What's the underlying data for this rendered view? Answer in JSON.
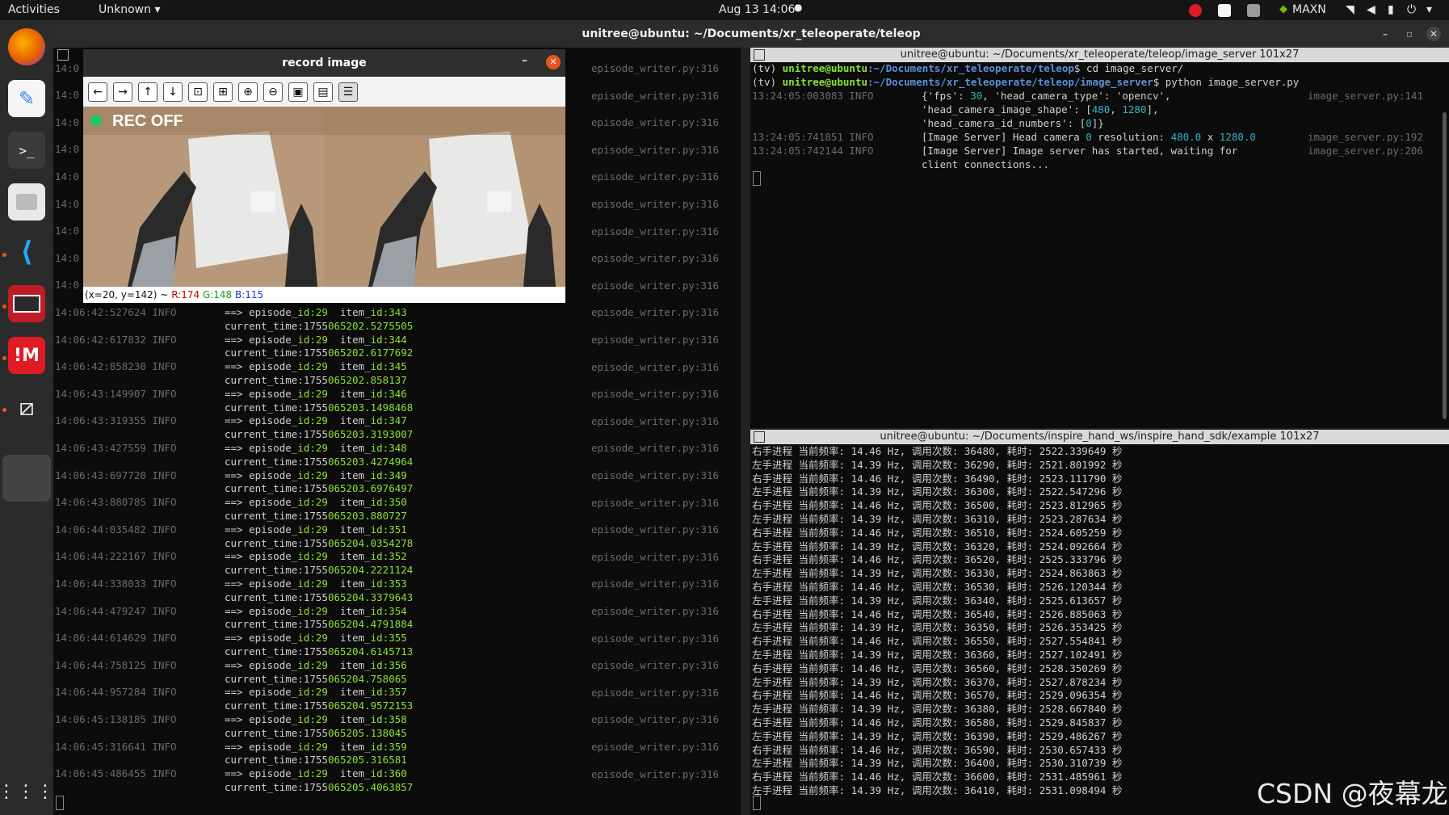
{
  "topbar": {
    "activities": "Activities",
    "app_menu": "Unknown",
    "clock": "Aug 13  14:06",
    "power_mode": "MAXN"
  },
  "window": {
    "title": "unitree@ubuntu: ~/Documents/xr_teleoperate/teleop"
  },
  "record_window": {
    "title": "record image",
    "rec_label": "REC OFF",
    "status_coords": "(x=20, y=142) ~",
    "status_r": "R:174",
    "status_g": "G:148",
    "status_b": "B:115"
  },
  "left_terminal": {
    "source_ref": "episode_writer.py:316",
    "top_timestamps": [
      "14:0",
      "14:0",
      "14:0",
      "14:0",
      "14:0",
      "14:0",
      "14:0",
      "14:0",
      "14:0"
    ],
    "entries": [
      {
        "ts": "14:06:42:527624",
        "level": "INFO",
        "item": "343",
        "time_a": "current_time:1755",
        "time_b": "065202.5275505"
      },
      {
        "ts": "14:06:42:617832",
        "level": "INFO",
        "item": "344",
        "time_a": "current_time:1755",
        "time_b": "065202.6177692"
      },
      {
        "ts": "14:06:42:858230",
        "level": "INFO",
        "item": "345",
        "time_a": "current_time:1755",
        "time_b": "065202.858137"
      },
      {
        "ts": "14:06:43:149907",
        "level": "INFO",
        "item": "346",
        "time_a": "current_time:1755",
        "time_b": "065203.1498468"
      },
      {
        "ts": "14:06:43:319355",
        "level": "INFO",
        "item": "347",
        "time_a": "current_time:1755",
        "time_b": "065203.3193007"
      },
      {
        "ts": "14:06:43:427559",
        "level": "INFO",
        "item": "348",
        "time_a": "current_time:1755",
        "time_b": "065203.4274964"
      },
      {
        "ts": "14:06:43:697720",
        "level": "INFO",
        "item": "349",
        "time_a": "current_time:1755",
        "time_b": "065203.6976497"
      },
      {
        "ts": "14:06:43:880785",
        "level": "INFO",
        "item": "350",
        "time_a": "current_time:1755",
        "time_b": "065203.880727"
      },
      {
        "ts": "14:06:44:035482",
        "level": "INFO",
        "item": "351",
        "time_a": "current_time:1755",
        "time_b": "065204.0354278"
      },
      {
        "ts": "14:06:44:222167",
        "level": "INFO",
        "item": "352",
        "time_a": "current_time:1755",
        "time_b": "065204.2221124"
      },
      {
        "ts": "14:06:44:338033",
        "level": "INFO",
        "item": "353",
        "time_a": "current_time:1755",
        "time_b": "065204.3379643"
      },
      {
        "ts": "14:06:44:479247",
        "level": "INFO",
        "item": "354",
        "time_a": "current_time:1755",
        "time_b": "065204.4791884"
      },
      {
        "ts": "14:06:44:614629",
        "level": "INFO",
        "item": "355",
        "time_a": "current_time:1755",
        "time_b": "065204.6145713"
      },
      {
        "ts": "14:06:44:758125",
        "level": "INFO",
        "item": "356",
        "time_a": "current_time:1755",
        "time_b": "065204.758065"
      },
      {
        "ts": "14:06:44:957284",
        "level": "INFO",
        "item": "357",
        "time_a": "current_time:1755",
        "time_b": "065204.9572153"
      },
      {
        "ts": "14:06:45:138185",
        "level": "INFO",
        "item": "358",
        "time_a": "current_time:1755",
        "time_b": "065205.138045"
      },
      {
        "ts": "14:06:45:316641",
        "level": "INFO",
        "item": "359",
        "time_a": "current_time:1755",
        "time_b": "065205.316581"
      },
      {
        "ts": "14:06:45:486455",
        "level": "INFO",
        "item": "360",
        "time_a": "current_time:1755",
        "time_b": "065205.4063857"
      }
    ],
    "episode_prefix": "==> episode_",
    "episode_id": "id:29",
    "item_prefix": "item_",
    "item_key": "id:"
  },
  "image_server_terminal": {
    "title": "unitree@ubuntu: ~/Documents/xr_teleoperate/teleop/image_server 101x27",
    "prompt1_env": "(tv) ",
    "prompt1_user": "unitree@ubuntu",
    "prompt1_path": ":~/Documents/xr_teleoperate/teleop",
    "prompt1_cmd": "$ cd image_server/",
    "prompt2_env": "(tv) ",
    "prompt2_user": "unitree@ubuntu",
    "prompt2_path": ":~/Documents/xr_teleoperate/teleop/image_server",
    "prompt2_cmd": "$ python image_server.py",
    "log1_ts": "13:24:05:003083 INFO",
    "log1_text1": "{'fps': ",
    "log1_fps": "30",
    "log1_text2": ", 'head_camera_type': 'opencv',",
    "log1_ref": "image_server.py:141",
    "log1_line2a": "'head_camera_image_shape': [",
    "log1_line2b": "480",
    "log1_line2c": ", ",
    "log1_line2d": "1280",
    "log1_line2e": "],",
    "log1_line3a": "'head_camera_id_numbers': [",
    "log1_line3b": "0",
    "log1_line3c": "]}",
    "log2_ts": "13:24:05:741851 INFO",
    "log2_text": "[Image Server] Head camera ",
    "log2_cam": "0",
    "log2_text2": " resolution: ",
    "log2_w": "480.0",
    "log2_x": " x ",
    "log2_h": "1280.0",
    "log2_ref": "image_server.py:192",
    "log3_ts": "13:24:05:742144 INFO",
    "log3_text": "[Image Server] Image server has started, waiting for",
    "log3_ref": "image_server.py:206",
    "log3_text2": "client connections..."
  },
  "hand_terminal": {
    "title": "unitree@ubuntu: ~/Documents/inspire_hand_ws/inspire_hand_sdk/example 101x27",
    "lines": [
      "右手进程 当前频率: 14.46 Hz, 调用次数: 36480, 耗时: 2522.339649 秒",
      "左手进程 当前频率: 14.39 Hz, 调用次数: 36290, 耗时: 2521.801992 秒",
      "右手进程 当前频率: 14.46 Hz, 调用次数: 36490, 耗时: 2523.111790 秒",
      "左手进程 当前频率: 14.39 Hz, 调用次数: 36300, 耗时: 2522.547296 秒",
      "右手进程 当前频率: 14.46 Hz, 调用次数: 36500, 耗时: 2523.812965 秒",
      "左手进程 当前频率: 14.39 Hz, 调用次数: 36310, 耗时: 2523.287634 秒",
      "右手进程 当前频率: 14.46 Hz, 调用次数: 36510, 耗时: 2524.605259 秒",
      "左手进程 当前频率: 14.39 Hz, 调用次数: 36320, 耗时: 2524.092664 秒",
      "右手进程 当前频率: 14.46 Hz, 调用次数: 36520, 耗时: 2525.333796 秒",
      "左手进程 当前频率: 14.39 Hz, 调用次数: 36330, 耗时: 2524.863863 秒",
      "右手进程 当前频率: 14.46 Hz, 调用次数: 36530, 耗时: 2526.120344 秒",
      "左手进程 当前频率: 14.39 Hz, 调用次数: 36340, 耗时: 2525.613657 秒",
      "右手进程 当前频率: 14.46 Hz, 调用次数: 36540, 耗时: 2526.885063 秒",
      "左手进程 当前频率: 14.39 Hz, 调用次数: 36350, 耗时: 2526.353425 秒",
      "右手进程 当前频率: 14.46 Hz, 调用次数: 36550, 耗时: 2527.554841 秒",
      "左手进程 当前频率: 14.39 Hz, 调用次数: 36360, 耗时: 2527.102491 秒",
      "右手进程 当前频率: 14.46 Hz, 调用次数: 36560, 耗时: 2528.350269 秒",
      "左手进程 当前频率: 14.39 Hz, 调用次数: 36370, 耗时: 2527.878234 秒",
      "右手进程 当前频率: 14.46 Hz, 调用次数: 36570, 耗时: 2529.096354 秒",
      "左手进程 当前频率: 14.39 Hz, 调用次数: 36380, 耗时: 2528.667840 秒",
      "右手进程 当前频率: 14.46 Hz, 调用次数: 36580, 耗时: 2529.845837 秒",
      "左手进程 当前频率: 14.39 Hz, 调用次数: 36390, 耗时: 2529.486267 秒",
      "右手进程 当前频率: 14.46 Hz, 调用次数: 36590, 耗时: 2530.657433 秒",
      "左手进程 当前频率: 14.39 Hz, 调用次数: 36400, 耗时: 2530.310739 秒",
      "右手进程 当前频率: 14.46 Hz, 调用次数: 36600, 耗时: 2531.485961 秒",
      "左手进程 当前频率: 14.39 Hz, 调用次数: 36410, 耗时: 2531.098494 秒"
    ]
  },
  "watermark": "CSDN @夜幕龙",
  "colors": {
    "accent": "#e95420",
    "rec_dot": "#22c55e",
    "terminal_bg": "#0c0c0c"
  }
}
